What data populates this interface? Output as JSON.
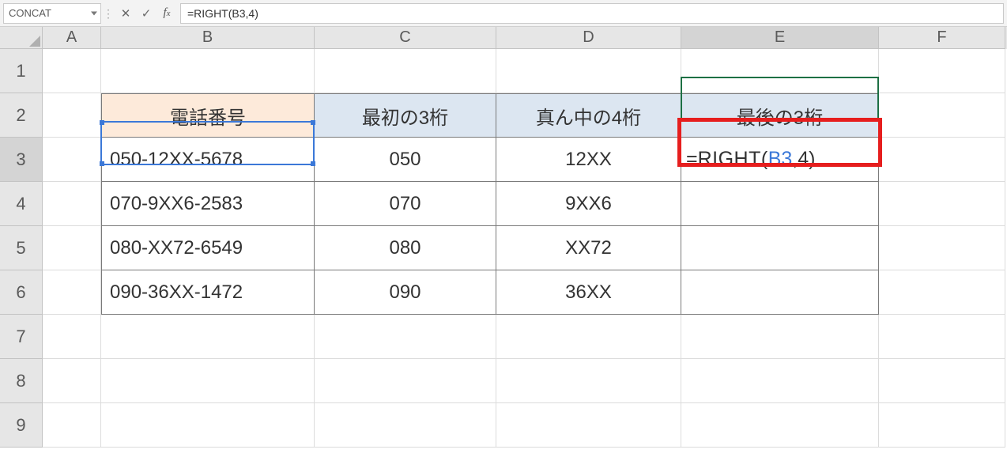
{
  "name_box": "CONCAT",
  "formula_bar": "=RIGHT(B3,4)",
  "columns": [
    "A",
    "B",
    "C",
    "D",
    "E",
    "F"
  ],
  "rows": [
    "1",
    "2",
    "3",
    "4",
    "5",
    "6",
    "7",
    "8",
    "9"
  ],
  "headers": {
    "phone": "電話番号",
    "first3": "最初の3桁",
    "mid4": "真ん中の4桁",
    "last3": "最後の3桁"
  },
  "table": [
    {
      "phone": "050-12XX-5678",
      "first3": "050",
      "mid4": "12XX",
      "last3_formula": {
        "eq": "=",
        "fn": "RIGHT(",
        "ref": "B3",
        "comma": ",",
        "arg": "4",
        "close": ")"
      }
    },
    {
      "phone": "070-9XX6-2583",
      "first3": "070",
      "mid4": "9XX6",
      "last3": ""
    },
    {
      "phone": "080-XX72-6549",
      "first3": "080",
      "mid4": "XX72",
      "last3": ""
    },
    {
      "phone": "090-36XX-1472",
      "first3": "090",
      "mid4": "36XX",
      "last3": ""
    }
  ],
  "icons": {
    "cancel": "cancel-icon",
    "confirm": "confirm-icon",
    "fx": "fx-icon",
    "dropdown": "chevron-down-icon"
  }
}
